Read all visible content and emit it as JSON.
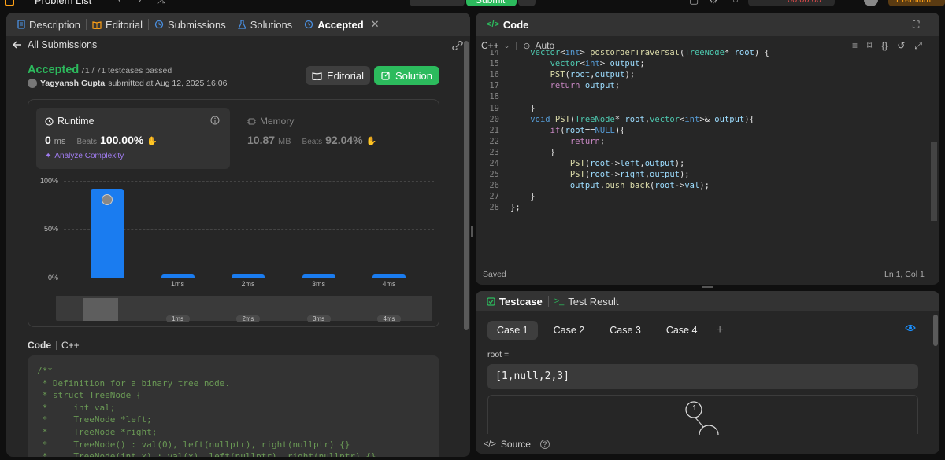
{
  "topbar": {
    "problem_list": "Problem List",
    "submit_label": "Submit",
    "timer": "00:00:00",
    "premium": "Premium"
  },
  "left_tabs": {
    "description": "Description",
    "editorial": "Editorial",
    "submissions": "Submissions",
    "solutions": "Solutions",
    "accepted": "Accepted",
    "close": "✕"
  },
  "submission": {
    "back_label": "All Submissions",
    "status": "Accepted",
    "testcases": "71 / 71 testcases passed",
    "user": "Yagyansh Gupta",
    "submitted_at": "submitted at Aug 12, 2025 16:06",
    "editorial_btn": "Editorial",
    "solution_btn": "Solution"
  },
  "runtime": {
    "label": "Runtime",
    "value": "0",
    "unit": "ms",
    "beats_label": "Beats",
    "beats": "100.00%",
    "analyze": "Analyze Complexity"
  },
  "memory": {
    "label": "Memory",
    "value": "10.87",
    "unit": "MB",
    "beats_label": "Beats",
    "beats": "92.04%"
  },
  "chart_data": {
    "type": "bar",
    "categories": [
      "0ms",
      "1ms",
      "2ms",
      "3ms",
      "4ms"
    ],
    "x_tick_labels": [
      "",
      "1ms",
      "2ms",
      "3ms",
      "4ms"
    ],
    "values": [
      92,
      3,
      3,
      3,
      3
    ],
    "y_ticks": [
      "100%",
      "50%",
      "0%"
    ],
    "ylim": [
      0,
      100
    ],
    "grid": true,
    "highlight_index": 0,
    "color": "#1a7cf0"
  },
  "code_section": {
    "label": "Code",
    "lang": "C++",
    "lines": [
      "/**",
      " * Definition for a binary tree node.",
      " * struct TreeNode {",
      " *     int val;",
      " *     TreeNode *left;",
      " *     TreeNode *right;",
      " *     TreeNode() : val(0), left(nullptr), right(nullptr) {}",
      " *     TreeNode(int x) : val(x), left(nullptr), right(nullptr) {}"
    ]
  },
  "code_panel": {
    "title": "Code",
    "lang": "C++",
    "mode": "Auto",
    "saved": "Saved",
    "cursor": "Ln 1, Col 1",
    "line_numbers": [
      "14",
      "15",
      "16",
      "17",
      "18",
      "19",
      "20",
      "21",
      "22",
      "23",
      "24",
      "25",
      "26",
      "27",
      "28"
    ]
  },
  "testcase": {
    "tab_label": "Testcase",
    "result_label": "Test Result",
    "cases": [
      "Case 1",
      "Case 2",
      "Case 3",
      "Case 4"
    ],
    "add": "+",
    "root_label": "root =",
    "root_value": "[1,null,2,3]",
    "tree_node": "1",
    "source_label": "Source",
    "help": "?"
  },
  "colors": {
    "accent_green": "#2cbb5d",
    "accepted_green": "#2cbb5d",
    "bar_blue": "#1a7cf0",
    "link_blue": "#1a90ff"
  }
}
